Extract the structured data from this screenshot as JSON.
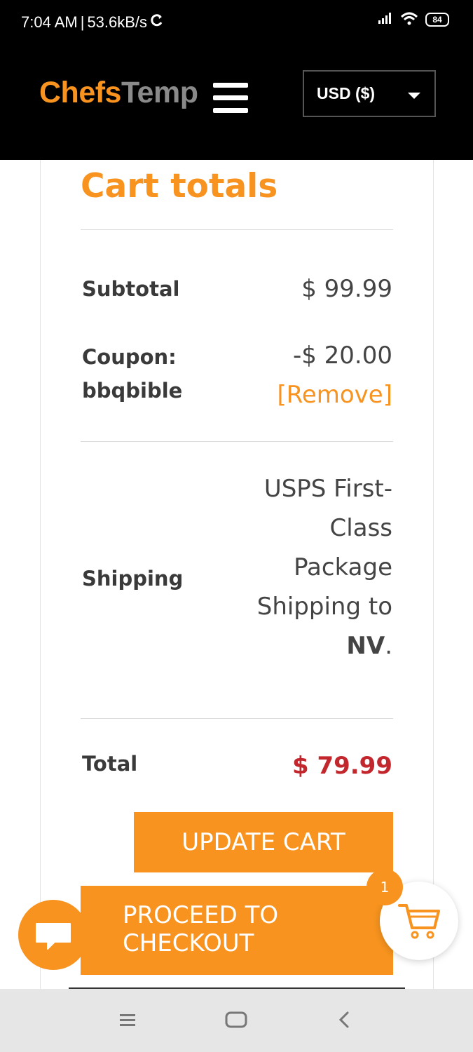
{
  "status_bar": {
    "time": "7:04 AM",
    "separator": "|",
    "speed": "53.6kB/s",
    "battery": "84"
  },
  "header": {
    "logo_part1": "Chefs",
    "logo_part2": "Temp",
    "currency": "USD ($)"
  },
  "cart_totals": {
    "title": "Cart totals",
    "subtotal_label": "Subtotal",
    "subtotal_value": "$ 99.99",
    "coupon_label_line1": "Coupon:",
    "coupon_label_line2": "bbqbible",
    "coupon_value": "-$ 20.00",
    "coupon_remove": "[Remove]",
    "shipping_label": "Shipping",
    "shipping_line1": "USPS First-",
    "shipping_line2": "Class",
    "shipping_line3": "Package",
    "shipping_line4": "Shipping to",
    "shipping_state": "NV",
    "shipping_period": ".",
    "total_label": "Total",
    "total_value": "$ 79.99"
  },
  "buttons": {
    "update_cart": "UPDATE CART",
    "checkout_line1": "PROCEED TO",
    "checkout_line2": "CHECKOUT"
  },
  "cart_fab": {
    "badge_count": "1"
  },
  "colors": {
    "accent": "#f7931e",
    "total": "#c1272d",
    "header_bg": "#000000"
  },
  "icons": {
    "status_sync": "sync-icon",
    "signal": "signal-icon",
    "wifi": "wifi-icon",
    "chat": "chat-icon",
    "cart": "cart-icon",
    "nav_menu": "menu-icon",
    "nav_home": "home-icon",
    "nav_back": "back-icon"
  }
}
